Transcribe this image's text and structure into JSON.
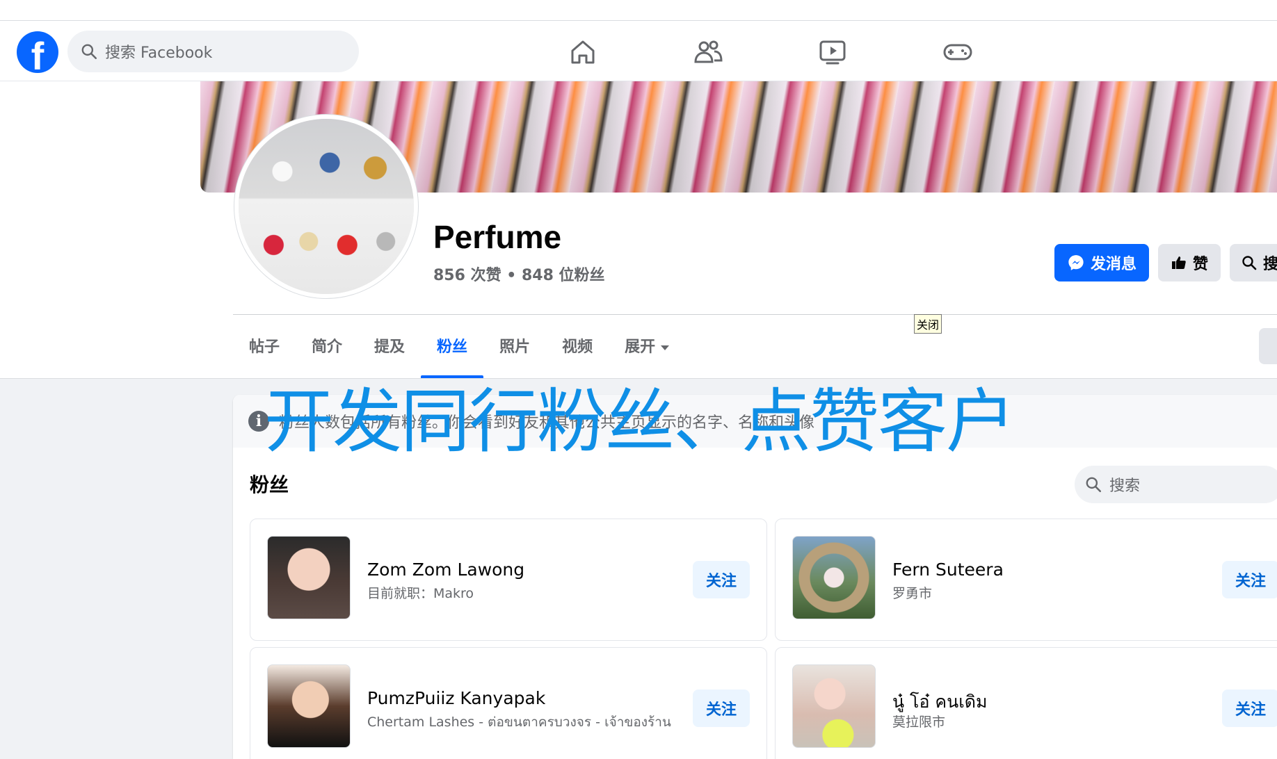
{
  "header": {
    "search_placeholder": "搜索 Facebook",
    "nav_icons": [
      "home-icon",
      "friends-icon",
      "watch-icon",
      "gaming-icon"
    ]
  },
  "page": {
    "name": "Perfume",
    "stats": "856 次赞 • 848 位粉丝",
    "buttons": {
      "message": "发消息",
      "like": "赞",
      "search": "搜"
    },
    "tooltip": "关闭",
    "tabs": [
      "帖子",
      "简介",
      "提及",
      "粉丝",
      "照片",
      "视频",
      "展开"
    ],
    "active_tab": "粉丝"
  },
  "followers": {
    "notice": "粉丝人数包括所有粉丝。你会看到好友和其他公共主页显示的名字、名称和头像",
    "overlay_text": "开发同行粉丝、点赞客户",
    "section_title": "粉丝",
    "search_placeholder": "搜索",
    "follow_label": "关注",
    "items": [
      {
        "name": "Zom Zom Lawong",
        "subtitle": "目前就职：Makro"
      },
      {
        "name": "Fern Suteera",
        "subtitle": "罗勇市"
      },
      {
        "name": "PumzPuiiz Kanyapak",
        "subtitle": "Chertam Lashes - ต่อขนตาครบวงจร - เจ้าของร้าน"
      },
      {
        "name": "นู๋ โอ๋ คนเดิม",
        "subtitle": "莫拉限市"
      }
    ]
  },
  "colors": {
    "brand_blue": "#0866ff",
    "overlay_blue": "#0f8fe6",
    "follow_bg": "#ebf5ff"
  }
}
